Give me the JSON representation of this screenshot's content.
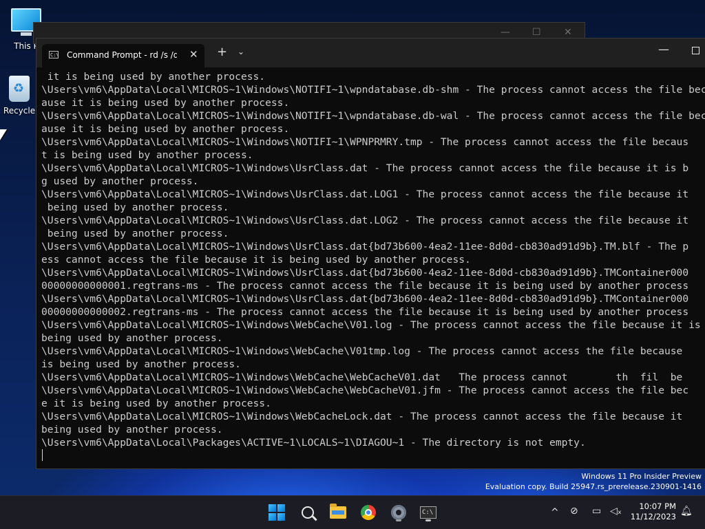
{
  "desktop": {
    "icons": [
      {
        "label": "This P",
        "icon": "monitor-icon"
      },
      {
        "label": "Recycle",
        "icon": "recycle-bin-icon"
      }
    ]
  },
  "terminal": {
    "tab_title": "Command Prompt - rd  /s /q :",
    "tab_close": "✕",
    "new_tab": "+",
    "dropdown": "⌄",
    "minimize": "—",
    "lines": [
      " it is being used by another process.",
      "\\Users\\vm6\\AppData\\Local\\MICROS~1\\Windows\\NOTIFI~1\\wpndatabase.db-shm - The process cannot access the file bec",
      "ause it is being used by another process.",
      "\\Users\\vm6\\AppData\\Local\\MICROS~1\\Windows\\NOTIFI~1\\wpndatabase.db-wal - The process cannot access the file bec",
      "ause it is being used by another process.",
      "\\Users\\vm6\\AppData\\Local\\MICROS~1\\Windows\\NOTIFI~1\\WPNPRMRY.tmp - The process cannot access the file becaus",
      "t is being used by another process.",
      "\\Users\\vm6\\AppData\\Local\\MICROS~1\\Windows\\UsrClass.dat - The process cannot access the file because it is b",
      "g used by another process.",
      "\\Users\\vm6\\AppData\\Local\\MICROS~1\\Windows\\UsrClass.dat.LOG1 - The process cannot access the file because it",
      " being used by another process.",
      "\\Users\\vm6\\AppData\\Local\\MICROS~1\\Windows\\UsrClass.dat.LOG2 - The process cannot access the file because it",
      " being used by another process.",
      "\\Users\\vm6\\AppData\\Local\\MICROS~1\\Windows\\UsrClass.dat{bd73b600-4ea2-11ee-8d0d-cb830ad91d9b}.TM.blf - The p",
      "ess cannot access the file because it is being used by another process.",
      "\\Users\\vm6\\AppData\\Local\\MICROS~1\\Windows\\UsrClass.dat{bd73b600-4ea2-11ee-8d0d-cb830ad91d9b}.TMContainer000",
      "00000000000001.regtrans-ms - The process cannot access the file because it is being used by another process",
      "\\Users\\vm6\\AppData\\Local\\MICROS~1\\Windows\\UsrClass.dat{bd73b600-4ea2-11ee-8d0d-cb830ad91d9b}.TMContainer000",
      "00000000000002.regtrans-ms - The process cannot access the file because it is being used by another process",
      "\\Users\\vm6\\AppData\\Local\\MICROS~1\\Windows\\WebCache\\V01.log - The process cannot access the file because it is",
      "being used by another process.",
      "\\Users\\vm6\\AppData\\Local\\MICROS~1\\Windows\\WebCache\\V01tmp.log - The process cannot access the file because",
      "is being used by another process.",
      "\\Users\\vm6\\AppData\\Local\\MICROS~1\\Windows\\WebCache\\WebCacheV01.dat   The process cannot        th  fil  be",
      "\\Users\\vm6\\AppData\\Local\\MICROS~1\\Windows\\WebCache\\WebCacheV01.jfm - The process cannot access the file bec",
      "e it is being used by another process.",
      "\\Users\\vm6\\AppData\\Local\\MICROS~1\\Windows\\WebCacheLock.dat - The process cannot access the file because it",
      "being used by another process.",
      "\\Users\\vm6\\AppData\\Local\\Packages\\ACTIVE~1\\LOCALS~1\\DIAGOU~1 - The directory is not empty."
    ]
  },
  "watermark": {
    "line1": "Windows 11 Pro Insider Preview",
    "line2": "Evaluation copy. Build 25947.rs_prerelease.230901-1416"
  },
  "taskbar": {
    "apps": [
      "start-button",
      "search-button",
      "file-explorer",
      "chrome",
      "settings",
      "terminal"
    ],
    "chevron": "^",
    "time": "10:07 PM",
    "date": "11/12/2023"
  }
}
